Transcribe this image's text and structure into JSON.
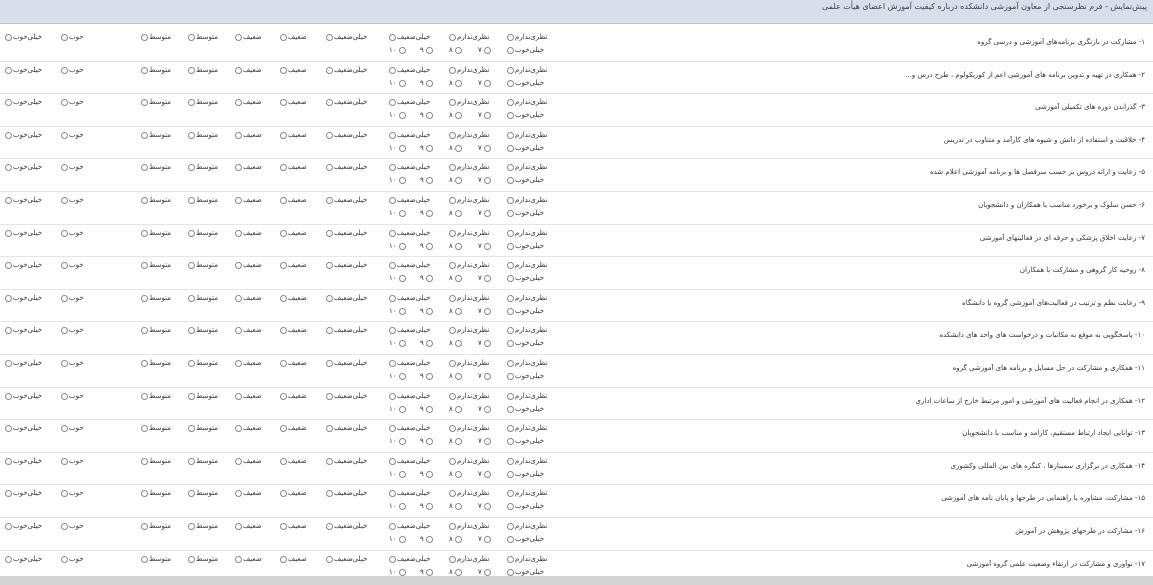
{
  "header": {
    "title": "پیش‌نمایش - فرم نظرسنجی از معاون آموزشی دانشکده درباره کیفیت آموزش اعضای هیأت علمی"
  },
  "choices": {
    "no_opinion": "نظری‌ندارم",
    "very_poor": "خیلی‌ضعیف",
    "poor": "ضعیف",
    "average": "متوسط",
    "good": "خوب",
    "very_good": "خیلی‌خوب",
    "n7": "۷",
    "n8": "۸",
    "n9": "۹",
    "n10": "۱۰"
  },
  "questions": [
    "۱- مشارکت در بازنگری برنامه‌های آموزشی و درسی گروه",
    "۲- همکاری در تهیه و تدوین برنامه های آموزشی اعم از کوریکولوم ، طرح درس و...",
    "۳- گذراندن دوره های تکمیلی آموزشی",
    "۴- خلاقیت و استفاده از دانش و شیوه های کارآمد و متناوب در تدریس",
    "۵- رعایت و ارائه دروس بر حسب سرفصل ها و برنامه آموزشی اعلام شده",
    "۶- حسن سلوک و برخورد مناسب با همکاران و دانشجویان",
    "۷- رعایت اخلاق پزشکی و حرفه ای در فعالیتهای آموزشی",
    "۸- روحیه کار گروهی و مشارکت با همکاران",
    "۹- رعایت نظم و ترتیب در فعالیت‌های آموزشی گروه یا دانشگاه",
    "۱۰- پاسخگویی به موقع به مکاتبات و درخواست های واحد های دانشکده",
    "۱۱- همکاری و مشارکت در حل مسایل و برنامه های آموزشی گروه",
    "۱۲- همکاری در انجام فعالیت های آموزشی و امور مرتبط خارج از ساعات اداری",
    "۱۳- توانایی ایجاد ارتباط مستقیم، کارامد و مناسب با دانشجویان",
    "۱۴- همکاری در برگزاری سمینارها ، کنگره های بین المللی وکشوری",
    "۱۵- مشارکت، مشاوره یا راهنمایی در طرحها و پایان نامه های آموزشی",
    "۱۶- مشارکت در طرحهای پژوهش در آموزش",
    "۱۷- نوآوری و مشارکت در ارتقاء وضعیت علمی گروه آموزشی"
  ]
}
